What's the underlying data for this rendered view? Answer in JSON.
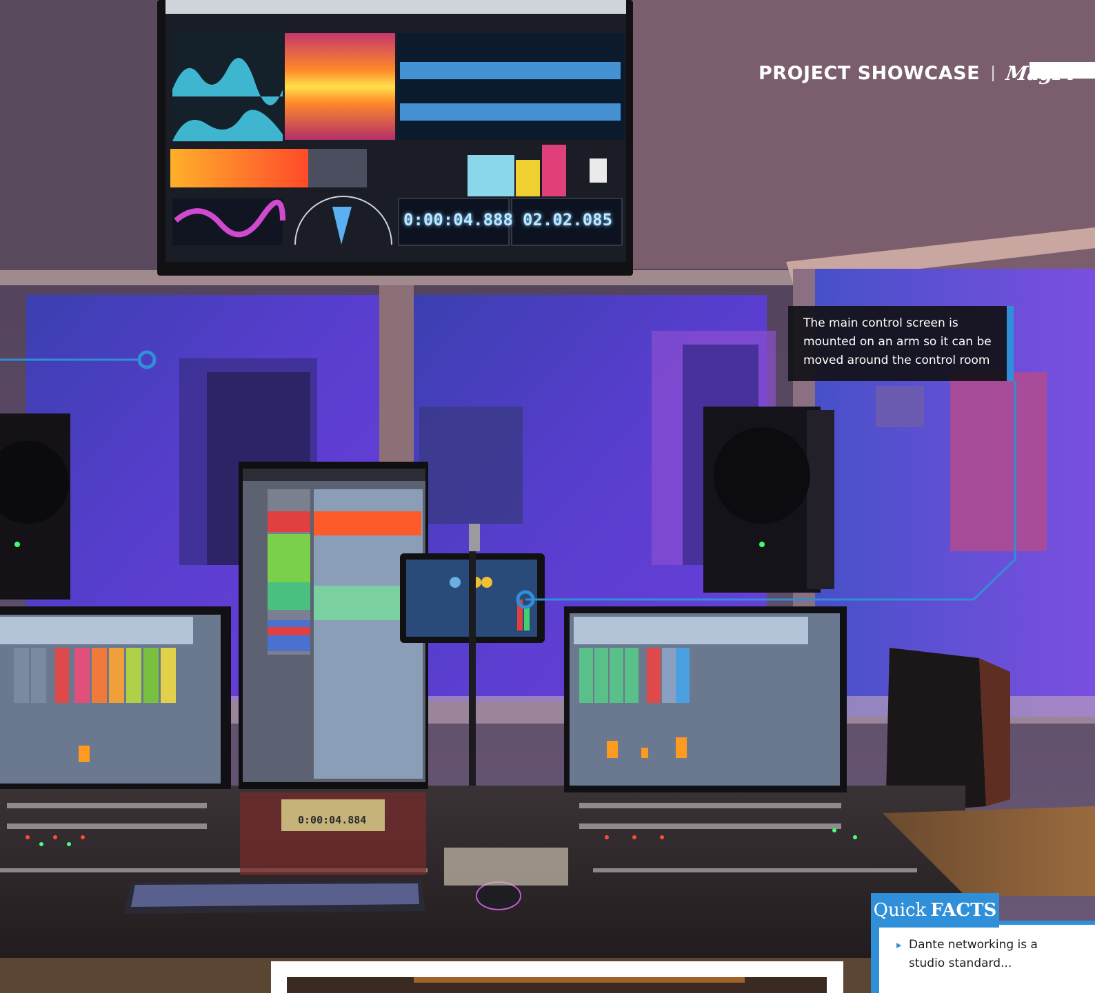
{
  "header": {
    "section_title": "PROJECT SHOWCASE",
    "separator": "|",
    "logo_text": "MagPi"
  },
  "callout": {
    "text": "The main control screen is mounted on an arm so it can be moved around the control room"
  },
  "quick_facts": {
    "title_light": "Quick",
    "title_bold": "FACTS",
    "items": [
      "Dante networking is a studio standard..."
    ]
  },
  "photo_readouts": {
    "main_timecode": "0:00:04.888",
    "secondary_timecode": "02.02.085",
    "console_timecode": "0:00:04.884"
  },
  "colors": {
    "accent_blue": "#2f8fd8",
    "header_text": "#ffffff",
    "callout_bg": "#121218"
  }
}
